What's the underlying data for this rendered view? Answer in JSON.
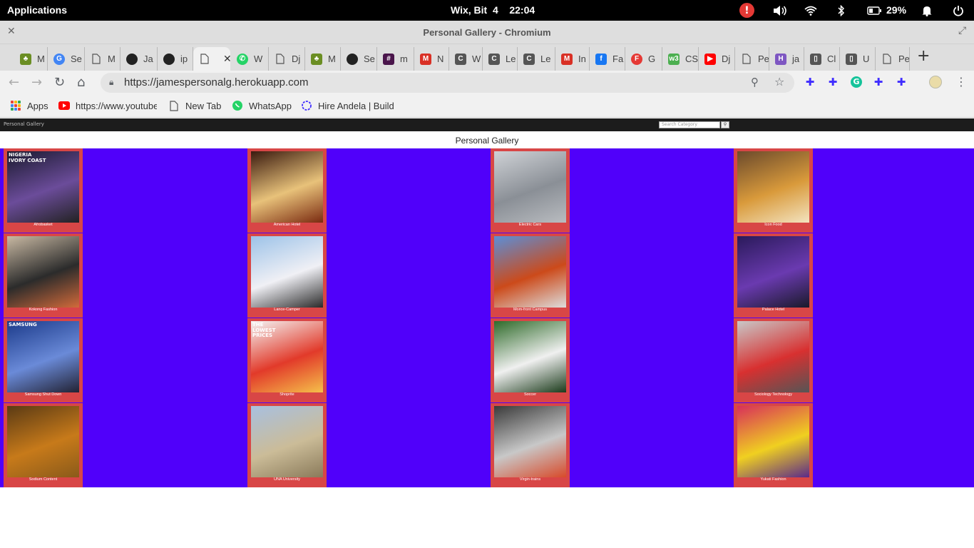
{
  "system": {
    "apps_label": "Applications",
    "datetime": "Wix, Bit  4    22:04",
    "battery": "29%",
    "icons": [
      "alert-icon",
      "volume-icon",
      "wifi-icon",
      "bluetooth-icon",
      "battery-icon",
      "bell-icon",
      "power-icon"
    ]
  },
  "window": {
    "title": "Personal Gallery - Chromium"
  },
  "tabs": [
    {
      "label": "M",
      "icon": "palm",
      "color": "#6b8e23"
    },
    {
      "label": "Se",
      "icon": "google",
      "color": "#4285f4"
    },
    {
      "label": "M",
      "icon": "page",
      "color": "#777"
    },
    {
      "label": "Ja",
      "icon": "github",
      "color": "#222"
    },
    {
      "label": "ip",
      "icon": "github",
      "color": "#222"
    },
    {
      "label": "",
      "icon": "page",
      "color": "#777",
      "active": true
    },
    {
      "label": "W",
      "icon": "whatsapp",
      "color": "#25d366"
    },
    {
      "label": "Dj",
      "icon": "page",
      "color": "#777"
    },
    {
      "label": "M",
      "icon": "palm",
      "color": "#6b8e23"
    },
    {
      "label": "Se",
      "icon": "github",
      "color": "#222"
    },
    {
      "label": "m",
      "icon": "slack",
      "color": "#4a154b"
    },
    {
      "label": "N",
      "icon": "gmail",
      "color": "#d93025"
    },
    {
      "label": "W",
      "icon": "classroom",
      "color": "#555"
    },
    {
      "label": "Le",
      "icon": "classroom",
      "color": "#555"
    },
    {
      "label": "Le",
      "icon": "classroom",
      "color": "#555"
    },
    {
      "label": "In",
      "icon": "gmail",
      "color": "#d93025"
    },
    {
      "label": "Fa",
      "icon": "facebook",
      "color": "#1877f2"
    },
    {
      "label": "G",
      "icon": "fcircle",
      "color": "#e53935"
    },
    {
      "label": "CS",
      "icon": "w3",
      "color": "#4caf50"
    },
    {
      "label": "Dj",
      "icon": "youtube",
      "color": "#ff0000"
    },
    {
      "label": "Pe",
      "icon": "page",
      "color": "#777"
    },
    {
      "label": "ja",
      "icon": "heroku",
      "color": "#7e57c2"
    },
    {
      "label": "Cl",
      "icon": "book",
      "color": "#555"
    },
    {
      "label": "U",
      "icon": "book",
      "color": "#555"
    },
    {
      "label": "Pe",
      "icon": "page",
      "color": "#777"
    }
  ],
  "address": {
    "url": "https://jamespersonalg.herokuapp.com"
  },
  "bookmarks": [
    {
      "label": "Apps",
      "icon": "apps-grid-icon"
    },
    {
      "label": "https://www.youtube",
      "icon": "youtube-icon"
    },
    {
      "label": "New Tab",
      "icon": "page-icon"
    },
    {
      "label": "WhatsApp",
      "icon": "whatsapp-icon"
    },
    {
      "label": "Hire Andela | Build",
      "icon": "andela-icon"
    }
  ],
  "site": {
    "brand": "Personal Gallery",
    "search_placeholder": "Search Category",
    "search_button_icon": "search-icon",
    "heading": "Personal Gallery"
  },
  "gallery": [
    {
      "caption": "Afrobasket",
      "colors": [
        "#1a1a2e",
        "#6b4c9a",
        "#222"
      ],
      "overlay": "NIGERIA\nIVORY COAST"
    },
    {
      "caption": "American Hotel",
      "colors": [
        "#3a1a0f",
        "#e8c27a",
        "#7a2a10"
      ],
      "overlay": ""
    },
    {
      "caption": "Electric Cars",
      "colors": [
        "#cfd2d6",
        "#8a8f96",
        "#b9bcc0"
      ],
      "overlay": ""
    },
    {
      "caption": "Icon Food",
      "colors": [
        "#6b4a2c",
        "#d99a3b",
        "#f3e3c0"
      ],
      "overlay": ""
    },
    {
      "caption": "Kokong Fashion",
      "colors": [
        "#c9b9a3",
        "#2b2b2b",
        "#d26a3a"
      ],
      "overlay": ""
    },
    {
      "caption": "Lance-Camper",
      "colors": [
        "#9cc2e8",
        "#f0f0f5",
        "#2a2a2a"
      ],
      "overlay": ""
    },
    {
      "caption": "Mom-front Campus",
      "colors": [
        "#5b8fd8",
        "#cc4a1a",
        "#ddd"
      ],
      "overlay": ""
    },
    {
      "caption": "Palace Hotel",
      "colors": [
        "#2a1a5a",
        "#6a3ab0",
        "#1a1a2a"
      ],
      "overlay": ""
    },
    {
      "caption": "Samsung Shut Down",
      "colors": [
        "#1b3a8a",
        "#6a8ad8",
        "#223"
      ],
      "overlay": "SAMSUNG"
    },
    {
      "caption": "Shoprite",
      "colors": [
        "#f4f4f4",
        "#e23a2a",
        "#f5c04a"
      ],
      "overlay": "THE\nLOWEST\nPRICES"
    },
    {
      "caption": "Soccer",
      "colors": [
        "#2f6b2a",
        "#f0f0f0",
        "#1a3a1a"
      ],
      "overlay": ""
    },
    {
      "caption": "Sociology Technology",
      "colors": [
        "#c8c8c8",
        "#d83030",
        "#555"
      ],
      "overlay": ""
    },
    {
      "caption": "Sodium Content",
      "colors": [
        "#5a3a14",
        "#c77a1a",
        "#8a5a1a"
      ],
      "overlay": ""
    },
    {
      "caption": "UNA University",
      "colors": [
        "#a8c0e0",
        "#cbbc98",
        "#8a7a5a"
      ],
      "overlay": ""
    },
    {
      "caption": "Virgin-trains",
      "colors": [
        "#3a3a3a",
        "#c8c8c8",
        "#d84a2a"
      ],
      "overlay": ""
    },
    {
      "caption": "Yukati Fashion",
      "colors": [
        "#d8305a",
        "#f0d020",
        "#5a2a8a"
      ],
      "overlay": ""
    }
  ]
}
